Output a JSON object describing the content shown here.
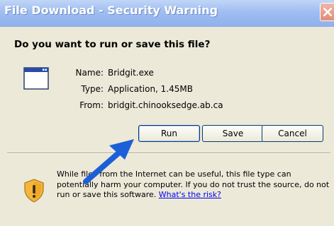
{
  "window": {
    "title": "File Download - Security Warning"
  },
  "question": "Do you want to run or save this file?",
  "file": {
    "name_label": "Name:",
    "name_value": "Bridgit.exe",
    "type_label": "Type:",
    "type_value": "Application, 1.45MB",
    "from_label": "From:",
    "from_value": "bridgit.chinooksedge.ab.ca"
  },
  "buttons": {
    "run": "Run",
    "save": "Save",
    "cancel": "Cancel"
  },
  "warning": {
    "line1": "While files from the Internet can be useful, this file type can",
    "line2": "potentially harm your computer. If you do not trust the source, do not",
    "line3_prefix": "run or save this software.",
    "link": "What's the risk?"
  },
  "icons": {
    "close": "close-icon",
    "file": "application-file-icon",
    "warning": "shield-warning-icon",
    "arrow": "pointer-arrow-annotation"
  },
  "colors": {
    "dialog_bg": "#ece9d8",
    "titlebar": "#9fbdf0",
    "close_button": "#e08d77",
    "link": "#0000ee",
    "arrow": "#1c5fd8"
  }
}
